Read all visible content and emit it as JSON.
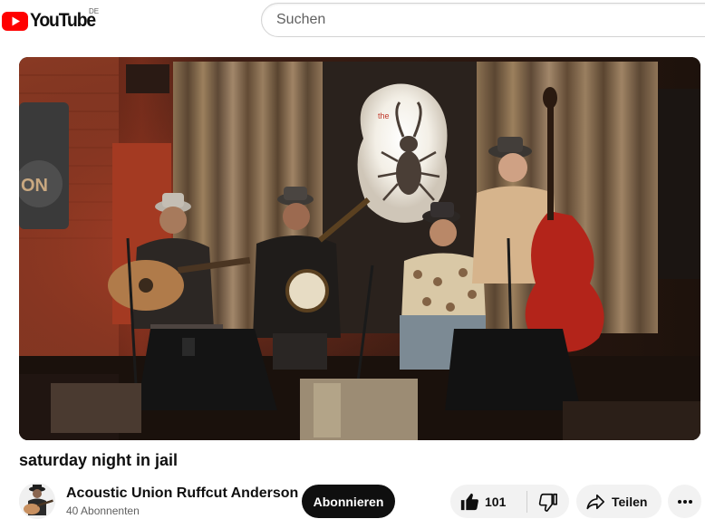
{
  "header": {
    "logo_text": "YouTube",
    "country_code": "DE",
    "search_placeholder": "Suchen"
  },
  "video": {
    "title": "saturday night in jail",
    "thumbnail_logo_text": "ON"
  },
  "channel": {
    "name": "Acoustic Union Ruffcut Anderson",
    "subscribers": "40 Abonnenten",
    "subscribe_label": "Abonnieren"
  },
  "actions": {
    "like_count": "101",
    "share_label": "Teilen"
  },
  "colors": {
    "brand_red": "#ff0000",
    "subscribe_bg": "#0f0f0f",
    "pill_bg": "#f2f2f2"
  },
  "icons": [
    "youtube-play-icon",
    "thumb-up-icon",
    "thumb-down-icon",
    "share-arrow-icon",
    "more-dots-icon"
  ]
}
